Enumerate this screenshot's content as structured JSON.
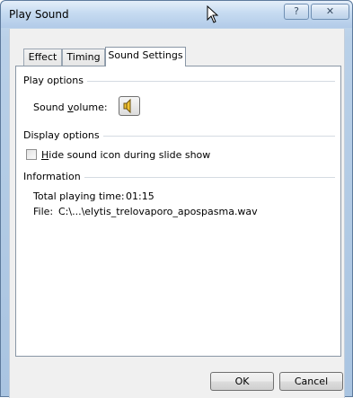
{
  "window": {
    "title": "Play Sound",
    "help_label": "?",
    "close_label": "✕"
  },
  "tabs": [
    {
      "label": "Effect",
      "active": false
    },
    {
      "label": "Timing",
      "active": false
    },
    {
      "label": "Sound Settings",
      "active": true
    }
  ],
  "play_options": {
    "heading": "Play options",
    "volume_label_pre": "Sound ",
    "volume_label_accel": "v",
    "volume_label_post": "olume:",
    "volume_icon": "speaker-icon"
  },
  "display_options": {
    "heading": "Display options",
    "checkbox_accel": "H",
    "checkbox_label_post": "ide sound icon during slide show",
    "checked": false
  },
  "information": {
    "heading": "Information",
    "total_playing_time_label": "Total playing time:",
    "total_playing_time_value": "01:15",
    "file_label": "File:",
    "file_value": "C:\\...\\elytis_trelovaporo_apospasma.wav"
  },
  "buttons": {
    "ok": "OK",
    "cancel": "Cancel"
  },
  "colors": {
    "title_bar": "#c6dbf1",
    "client_bg": "#f0f0f0",
    "panel_bg": "#ffffff",
    "speaker": "#f2c230"
  }
}
